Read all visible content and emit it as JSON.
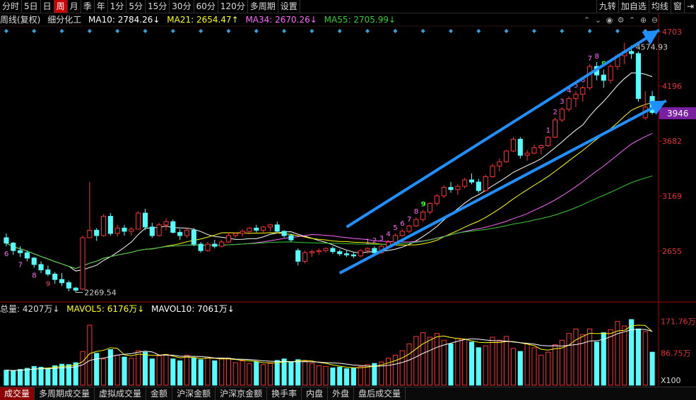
{
  "toolbar": {
    "items": [
      "分时",
      "5日",
      "日",
      "周",
      "月",
      "季",
      "年",
      "1分",
      "5分",
      "15分",
      "30分",
      "60分",
      "120分",
      "多周期",
      "设置"
    ],
    "active_index": 3,
    "right_items": [
      "九转",
      "加自选",
      "均线",
      "窗"
    ],
    "right_icon": "exit-icon"
  },
  "info": {
    "title": "周线(复权)",
    "name": "细分化工",
    "ma10": "MA10: 2784.26↓",
    "ma21": "MA21: 2654.47↑",
    "ma34": "MA34: 2670.26↓",
    "ma55": "MA55: 2705.99↓"
  },
  "volume_info": {
    "total": "总量: 4207万↓",
    "mavol5": "MAVOL5: 6176万↓",
    "mavol10": "MAVOL10: 7061万↓"
  },
  "price_axis": {
    "labels": [
      "4703",
      "4196",
      "3682",
      "3169",
      "2655"
    ],
    "current": "3946"
  },
  "volume_axis": {
    "labels": [
      "171.76万",
      "86.75万"
    ],
    "multiplier": "X100"
  },
  "annotations": {
    "high": "4574.93",
    "low": "2269.54"
  },
  "bottom_tabs": [
    "成交量",
    "多周期成交量",
    "虚拟成交量",
    "金额",
    "沪深金额",
    "沪深京金额",
    "换手率",
    "内盘",
    "外盘",
    "盘后成交量"
  ],
  "bottom_active": 0,
  "colors": {
    "up": "#ff3232",
    "down": "#54ffff",
    "ma10": "#ffffff",
    "ma21": "#ffff00",
    "ma34": "#ff66ff",
    "ma55": "#33cc33",
    "arrow": "#1e90ff"
  },
  "chart_data": {
    "type": "candlestick",
    "period": "weekly",
    "ohlc": [
      [
        2780,
        2820,
        2700,
        2730
      ],
      [
        2730,
        2740,
        2620,
        2660
      ],
      [
        2660,
        2700,
        2600,
        2640
      ],
      [
        2640,
        2660,
        2560,
        2590
      ],
      [
        2590,
        2600,
        2500,
        2530
      ],
      [
        2530,
        2560,
        2450,
        2480
      ],
      [
        2480,
        2520,
        2420,
        2440
      ],
      [
        2440,
        2460,
        2350,
        2390
      ],
      [
        2390,
        2450,
        2330,
        2360
      ],
      [
        2360,
        2380,
        2280,
        2310
      ],
      [
        2310,
        2320,
        2269.54,
        2290
      ],
      [
        2300,
        2800,
        2290,
        2780
      ],
      [
        2780,
        3300,
        2780,
        2850
      ],
      [
        2850,
        2870,
        2750,
        2800
      ],
      [
        2800,
        3000,
        2790,
        2980
      ],
      [
        2980,
        3010,
        2800,
        2820
      ],
      [
        2820,
        2900,
        2790,
        2870
      ],
      [
        2870,
        2900,
        2800,
        2840
      ],
      [
        2840,
        2880,
        2800,
        2860
      ],
      [
        2860,
        3030,
        2860,
        3010
      ],
      [
        3010,
        3050,
        2850,
        2880
      ],
      [
        2880,
        2920,
        2780,
        2800
      ],
      [
        2800,
        2920,
        2790,
        2900
      ],
      [
        2900,
        2960,
        2850,
        2930
      ],
      [
        2930,
        2950,
        2820,
        2830
      ],
      [
        2830,
        2860,
        2760,
        2800
      ],
      [
        2800,
        2870,
        2780,
        2850
      ],
      [
        2850,
        2870,
        2700,
        2720
      ],
      [
        2720,
        2740,
        2640,
        2660
      ],
      [
        2660,
        2740,
        2650,
        2720
      ],
      [
        2720,
        2760,
        2680,
        2700
      ],
      [
        2700,
        2760,
        2690,
        2740
      ],
      [
        2740,
        2830,
        2730,
        2800
      ],
      [
        2800,
        2830,
        2780,
        2820
      ],
      [
        2820,
        2860,
        2790,
        2840
      ],
      [
        2840,
        2880,
        2810,
        2870
      ],
      [
        2870,
        2900,
        2830,
        2850
      ],
      [
        2850,
        2890,
        2820,
        2880
      ],
      [
        2880,
        2910,
        2840,
        2900
      ],
      [
        2900,
        2930,
        2830,
        2840
      ],
      [
        2840,
        2850,
        2780,
        2800
      ],
      [
        2800,
        2820,
        2740,
        2760
      ],
      [
        2660,
        2680,
        2520,
        2560
      ],
      [
        2560,
        2660,
        2540,
        2640
      ],
      [
        2640,
        2670,
        2600,
        2650
      ],
      [
        2650,
        2680,
        2620,
        2660
      ],
      [
        2660,
        2690,
        2640,
        2680
      ],
      [
        2680,
        2700,
        2630,
        2650
      ],
      [
        2650,
        2670,
        2610,
        2630
      ],
      [
        2630,
        2660,
        2600,
        2620
      ],
      [
        2620,
        2650,
        2590,
        2610
      ],
      [
        2610,
        2670,
        2600,
        2660
      ],
      [
        2660,
        2690,
        2630,
        2680
      ],
      [
        2680,
        2700,
        2620,
        2640
      ],
      [
        2640,
        2720,
        2630,
        2700
      ],
      [
        2700,
        2760,
        2690,
        2740
      ],
      [
        2740,
        2820,
        2730,
        2800
      ],
      [
        2800,
        2860,
        2790,
        2840
      ],
      [
        2840,
        2900,
        2820,
        2890
      ],
      [
        2890,
        2970,
        2880,
        2950
      ],
      [
        2950,
        3040,
        2930,
        3020
      ],
      [
        3020,
        3110,
        3000,
        3100
      ],
      [
        3100,
        3190,
        3080,
        3170
      ],
      [
        3170,
        3270,
        3150,
        3250
      ],
      [
        3250,
        3300,
        3200,
        3230
      ],
      [
        3230,
        3280,
        3180,
        3260
      ],
      [
        3260,
        3340,
        3240,
        3320
      ],
      [
        3320,
        3380,
        3280,
        3300
      ],
      [
        3300,
        3330,
        3200,
        3220
      ],
      [
        3220,
        3370,
        3210,
        3350
      ],
      [
        3350,
        3470,
        3340,
        3450
      ],
      [
        3450,
        3520,
        3400,
        3490
      ],
      [
        3490,
        3600,
        3480,
        3590
      ],
      [
        3590,
        3720,
        3580,
        3700
      ],
      [
        3700,
        3720,
        3520,
        3550
      ],
      [
        3550,
        3600,
        3500,
        3570
      ],
      [
        3570,
        3650,
        3560,
        3620
      ],
      [
        3620,
        3650,
        3560,
        3640
      ],
      [
        3640,
        3730,
        3630,
        3720
      ],
      [
        3720,
        3900,
        3710,
        3880
      ],
      [
        3880,
        4000,
        3860,
        3980
      ],
      [
        3980,
        4100,
        3960,
        4080
      ],
      [
        4080,
        4150,
        4000,
        4120
      ],
      [
        4120,
        4200,
        4050,
        4180
      ],
      [
        4180,
        4400,
        4160,
        4380
      ],
      [
        4380,
        4420,
        4250,
        4300
      ],
      [
        4300,
        4350,
        4180,
        4250
      ],
      [
        4250,
        4400,
        4220,
        4380
      ],
      [
        4380,
        4500,
        4350,
        4480
      ],
      [
        4480,
        4600,
        4400,
        4520
      ],
      [
        4520,
        4574.93,
        4450,
        4500
      ],
      [
        4500,
        4520,
        4050,
        4080
      ],
      [
        3900,
        4150,
        3880,
        4000
      ],
      [
        4100,
        4150,
        3930,
        3950
      ]
    ],
    "volume": [
      40,
      38,
      42,
      45,
      50,
      48,
      44,
      52,
      56,
      55,
      60,
      90,
      160,
      85,
      70,
      95,
      80,
      75,
      72,
      92,
      88,
      70,
      78,
      82,
      70,
      65,
      80,
      72,
      68,
      75,
      65,
      70,
      72,
      60,
      65,
      58,
      62,
      55,
      58,
      66,
      70,
      62,
      68,
      64,
      58,
      52,
      50,
      46,
      48,
      44,
      45,
      50,
      55,
      58,
      62,
      72,
      80,
      92,
      110,
      130,
      140,
      128,
      138,
      120,
      110,
      125,
      122,
      115,
      100,
      105,
      128,
      120,
      130,
      98,
      90,
      110,
      100,
      80,
      88,
      108,
      120,
      138,
      150,
      135,
      150,
      115,
      140,
      148,
      170,
      158,
      175,
      150,
      143,
      88
    ],
    "ylim": [
      2200,
      4750
    ],
    "y_ticks": [
      4703,
      4196,
      3682,
      3169,
      2655
    ],
    "vol_ticks": [
      171.76,
      86.75
    ],
    "high_label": 4574.93,
    "low_label": 2269.54,
    "current": 3946,
    "trend_arrows": [
      {
        "from": [
          49,
          2880
        ],
        "to": [
          94,
          4720
        ]
      },
      {
        "from": [
          48,
          2450
        ],
        "to": [
          95,
          4060
        ]
      }
    ],
    "nine_turn_down": {
      "start": 0,
      "labels": [
        "6",
        "7",
        "8",
        "9"
      ]
    },
    "nine_turn_up": {
      "start": 52,
      "labels": [
        "1",
        "2",
        "3",
        "4",
        "5",
        "6",
        "7",
        "8",
        "9"
      ]
    },
    "nine_turn_up_2": {
      "start": 78,
      "labels": [
        "1",
        "2",
        "3",
        "4",
        "5",
        "6",
        "7",
        "8",
        "9"
      ]
    }
  }
}
